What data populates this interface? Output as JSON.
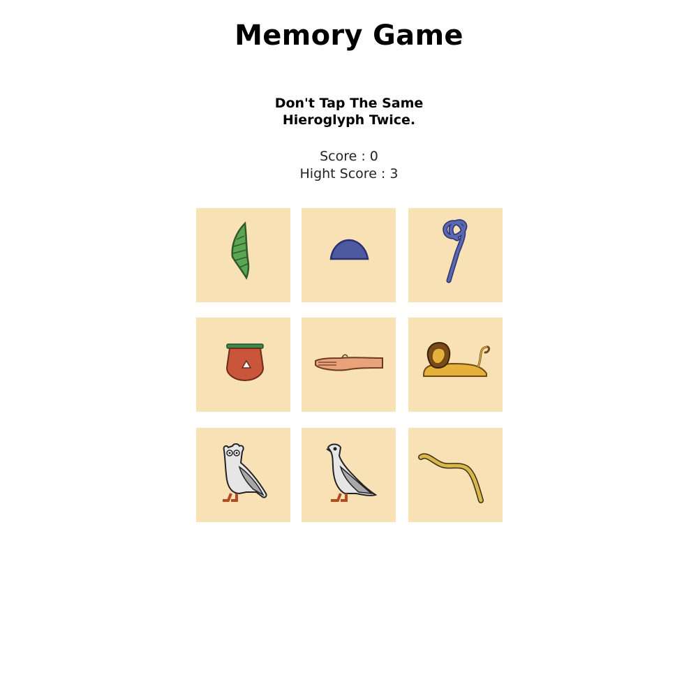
{
  "game": {
    "title": "Memory Game",
    "instruction_line1": "Don't Tap The Same",
    "instruction_line2": "Hieroglyph Twice.",
    "score_text": "Score : 0",
    "high_score_text": "Hight Score : 3"
  },
  "tiles": [
    {
      "glyph": "reed-leaf-icon",
      "color": "#4c9a4a"
    },
    {
      "glyph": "bread-loaf-icon",
      "color": "#4c5a9c"
    },
    {
      "glyph": "rope-coil-icon",
      "color": "#4c5a9c"
    },
    {
      "glyph": "basket-with-handle-icon",
      "color": "#c9563a"
    },
    {
      "glyph": "arm-hand-icon",
      "color": "#e7a07b"
    },
    {
      "glyph": "lion-icon",
      "color": "#e3b33a"
    },
    {
      "glyph": "owl-icon",
      "color": "#d9d9d9"
    },
    {
      "glyph": "vulture-icon",
      "color": "#d9d9d9"
    },
    {
      "glyph": "horned-viper-icon",
      "color": "#d8b84a"
    }
  ],
  "colors": {
    "tile_background": "#f9e1b6",
    "page_background": "#ffffff"
  }
}
